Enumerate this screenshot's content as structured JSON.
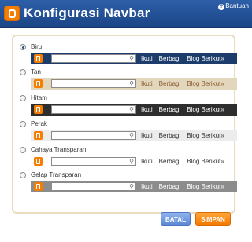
{
  "header": {
    "title": "Konfigurasi Navbar",
    "help_label": "Bantuan",
    "accent": "#1b4586"
  },
  "navbar_links": {
    "follow": "Ikuti",
    "share": "Berbagi",
    "next_blog": "Blog Berikut»"
  },
  "options": [
    {
      "label": "Biru",
      "checked": true,
      "bar_color": "#1c3d6b",
      "text_color": "#ffffff"
    },
    {
      "label": "Tan",
      "checked": false,
      "bar_color": "#e2d6bc",
      "text_color": "#8a5a2b"
    },
    {
      "label": "Hitam",
      "checked": false,
      "bar_color": "#2e2e2e",
      "text_color": "#ffffff"
    },
    {
      "label": "Perak",
      "checked": false,
      "bar_color": "#ececec",
      "text_color": "#333333"
    },
    {
      "label": "Cahaya Transparan",
      "checked": false,
      "bar_color": "#ffffff",
      "text_color": "#333333"
    },
    {
      "label": "Gelap Transparan",
      "checked": false,
      "bar_color": "#8c8c8c",
      "text_color": "#ffffff"
    }
  ],
  "buttons": {
    "cancel": "BATAL",
    "save": "SIMPAN"
  }
}
